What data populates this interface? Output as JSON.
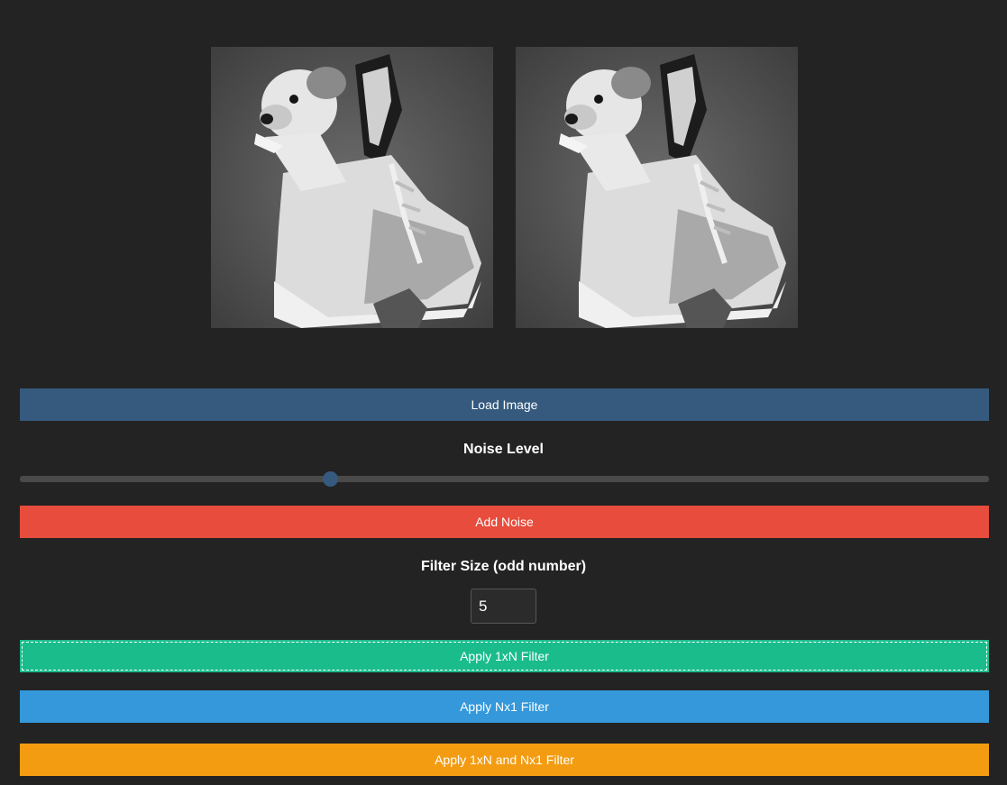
{
  "images": {
    "original": {
      "description_icon": "puppy-in-sneaker-image"
    },
    "processed": {
      "description_icon": "puppy-in-sneaker-image"
    }
  },
  "controls": {
    "load_label": "Load Image",
    "noise_heading": "Noise Level",
    "noise_level_fraction": 0.32,
    "add_noise_label": "Add Noise",
    "filter_heading": "Filter Size (odd number)",
    "filter_size": "5",
    "apply_1xn_label": "Apply 1xN Filter",
    "apply_nx1_label": "Apply Nx1 Filter",
    "apply_both_label": "Apply 1xN and Nx1 Filter"
  },
  "colors": {
    "background": "#232323",
    "load": "#355a7e",
    "noise": "#e74c3c",
    "apply_1xn": "#1abc8c",
    "apply_nx1": "#3498db",
    "apply_both": "#f39c12"
  }
}
